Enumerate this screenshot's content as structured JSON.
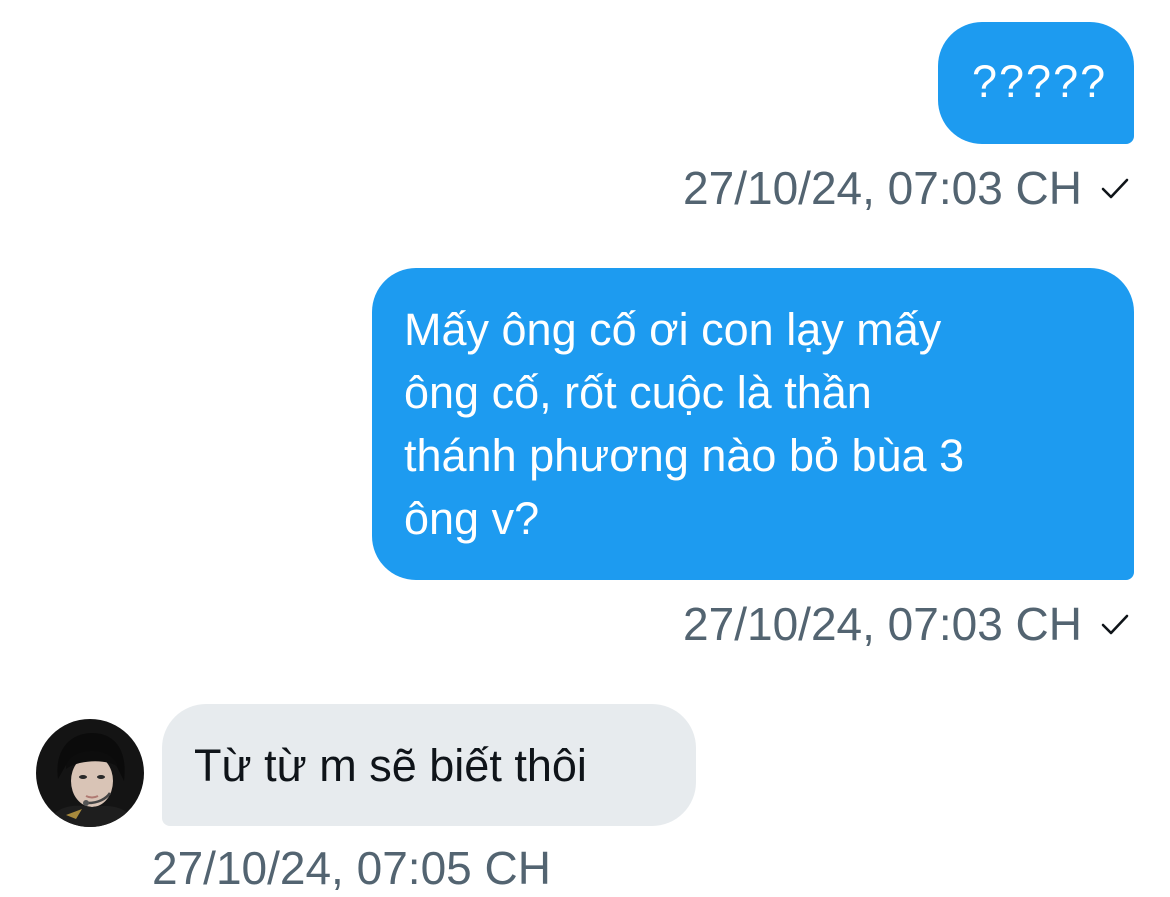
{
  "conversation": {
    "messages": [
      {
        "direction": "outgoing",
        "text": "?????",
        "timestamp": "27/10/24, 07:03 CH",
        "status_icon": "checkmark-icon"
      },
      {
        "direction": "outgoing",
        "lines": [
          "Mấy ông cố ơi con lạy mấy",
          "ông cố, rốt cuộc là thần",
          "thánh phương nào bỏ bùa 3",
          "ông v?"
        ],
        "timestamp": "27/10/24, 07:03 CH",
        "status_icon": "checkmark-icon"
      },
      {
        "direction": "incoming",
        "text": "Từ từ m sẽ biết thôi",
        "timestamp": "27/10/24, 07:05 CH",
        "avatar_icon": "user-avatar"
      }
    ]
  },
  "colors": {
    "outgoing_bubble": "#1d9bf0",
    "incoming_bubble": "#e7ebee",
    "timestamp_text": "#536471",
    "background": "#ffffff"
  }
}
